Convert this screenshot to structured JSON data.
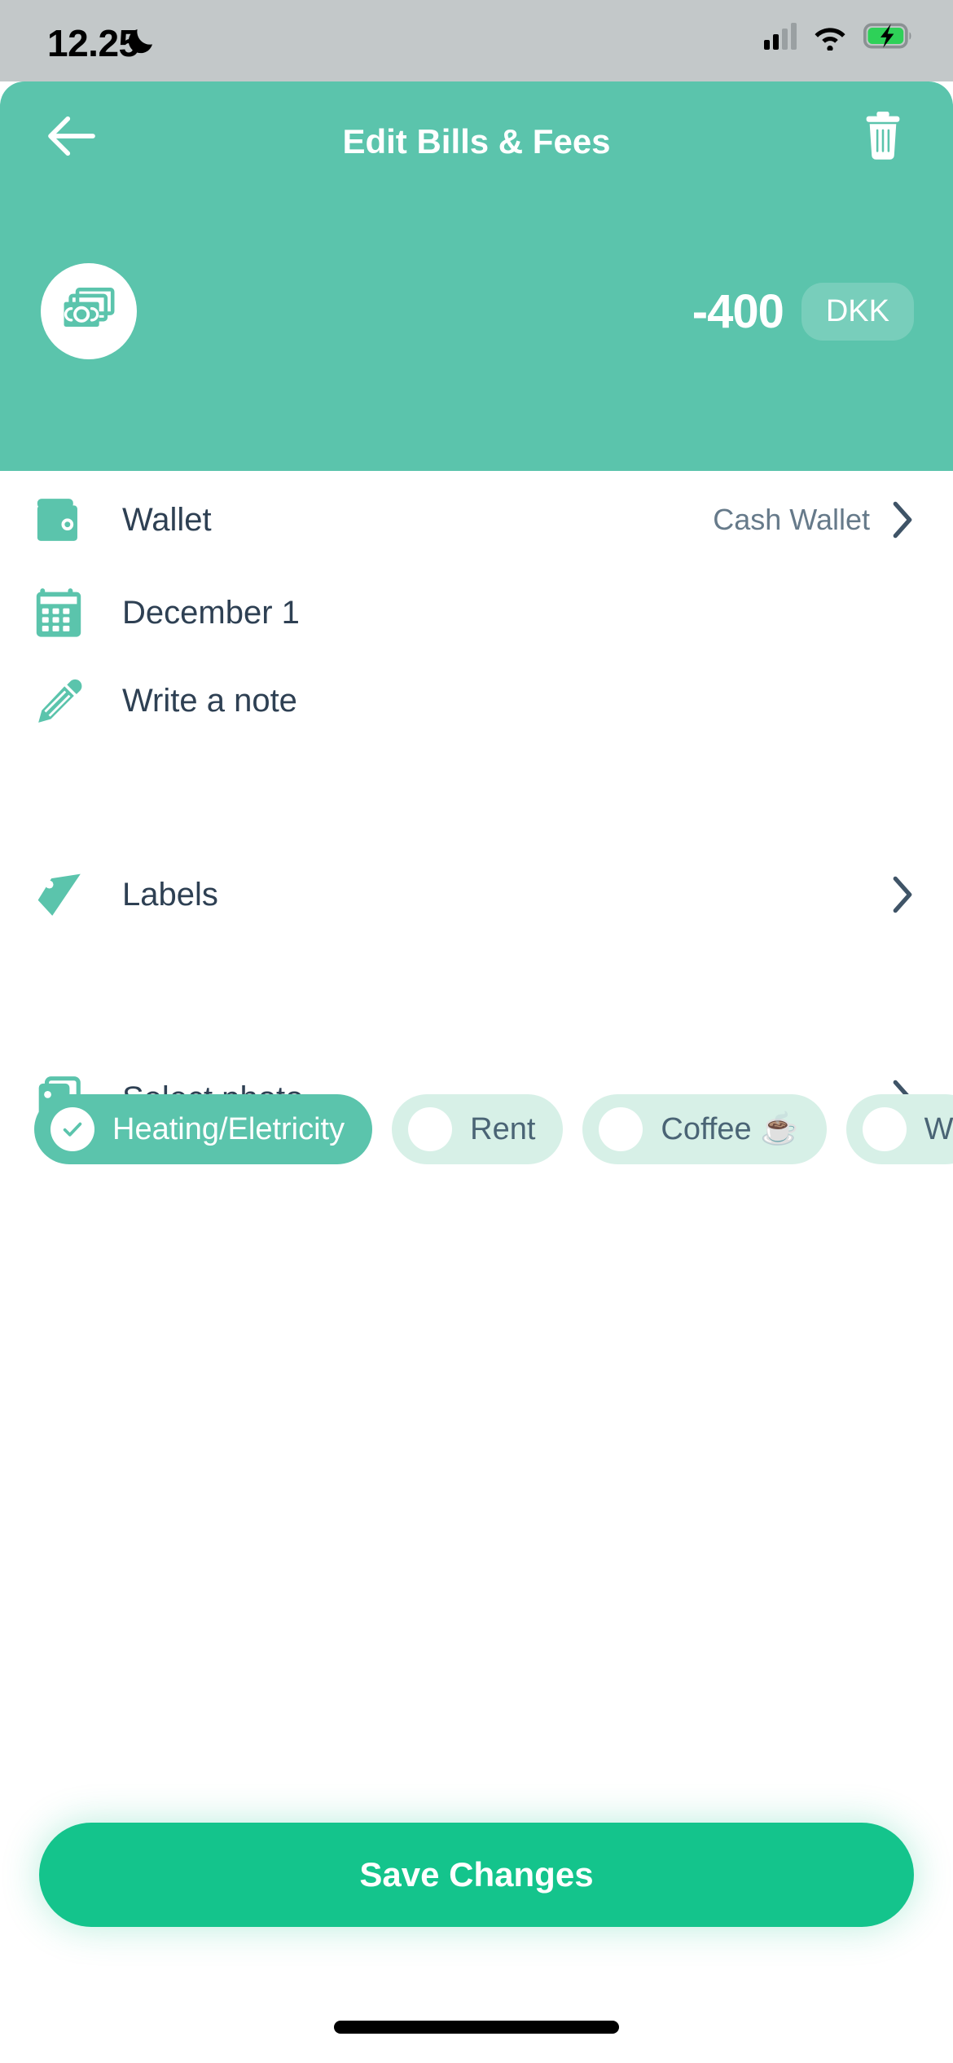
{
  "status_bar": {
    "time": "12.25",
    "dnd_icon": "crescent-moon-icon",
    "signal_icon": "cellular-signal-icon",
    "wifi_icon": "wifi-icon",
    "battery_icon": "battery-charging-icon"
  },
  "header": {
    "title": "Edit Bills & Fees",
    "back_icon": "back-arrow-icon",
    "delete_icon": "trash-icon",
    "category_icon": "banknotes-icon",
    "amount": "-400",
    "currency": "DKK",
    "background_color": "#5bc4ac"
  },
  "rows": {
    "wallet": {
      "label": "Wallet",
      "value": "Cash Wallet",
      "icon": "wallet-icon",
      "chevron": "chevron-right-icon"
    },
    "date": {
      "label": "December 1",
      "icon": "calendar-icon"
    },
    "note": {
      "label": "Write a note",
      "icon": "pencil-icon"
    },
    "labels": {
      "label": "Labels",
      "icon": "tag-icon",
      "chevron": "chevron-right-icon"
    },
    "photo": {
      "label": "Select photo",
      "icon": "photo-icon",
      "chevron": "chevron-right-icon"
    }
  },
  "label_chips": [
    {
      "name": "Heating/Eletricity",
      "selected": true
    },
    {
      "name": "Rent",
      "selected": false
    },
    {
      "name": "Coffee ☕",
      "selected": false
    },
    {
      "name": "W",
      "selected": false
    }
  ],
  "footer": {
    "save_label": "Save Changes",
    "save_color": "#14c48c"
  }
}
